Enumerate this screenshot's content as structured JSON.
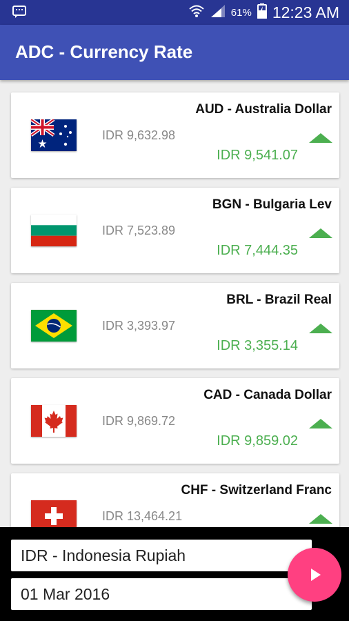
{
  "status_bar": {
    "battery": "61%",
    "time": "12:23 AM"
  },
  "app_bar": {
    "title": "ADC - Currency Rate"
  },
  "currencies": [
    {
      "name": "AUD - Australia Dollar",
      "buy": "IDR 9,632.98",
      "sell": "IDR 9,541.07",
      "trend": "up",
      "flag_icon": "australia-flag-icon"
    },
    {
      "name": "BGN - Bulgaria Lev",
      "buy": "IDR 7,523.89",
      "sell": "IDR 7,444.35",
      "trend": "up",
      "flag_icon": "bulgaria-flag-icon"
    },
    {
      "name": "BRL - Brazil Real",
      "buy": "IDR 3,393.97",
      "sell": "IDR 3,355.14",
      "trend": "up",
      "flag_icon": "brazil-flag-icon"
    },
    {
      "name": "CAD - Canada Dollar",
      "buy": "IDR 9,869.72",
      "sell": "IDR 9,859.02",
      "trend": "up",
      "flag_icon": "canada-flag-icon"
    },
    {
      "name": "CHF - Switzerland Franc",
      "buy": "IDR 13,464.21",
      "sell": "",
      "trend": "up",
      "flag_icon": "switzerland-flag-icon"
    }
  ],
  "bottom_panel": {
    "base_currency": "IDR - Indonesia Rupiah",
    "date": "01 Mar 2016"
  },
  "colors": {
    "status_bar": "#283593",
    "app_bar": "#3f51b5",
    "up_trend": "#4caf50",
    "fab": "#ff4081"
  }
}
